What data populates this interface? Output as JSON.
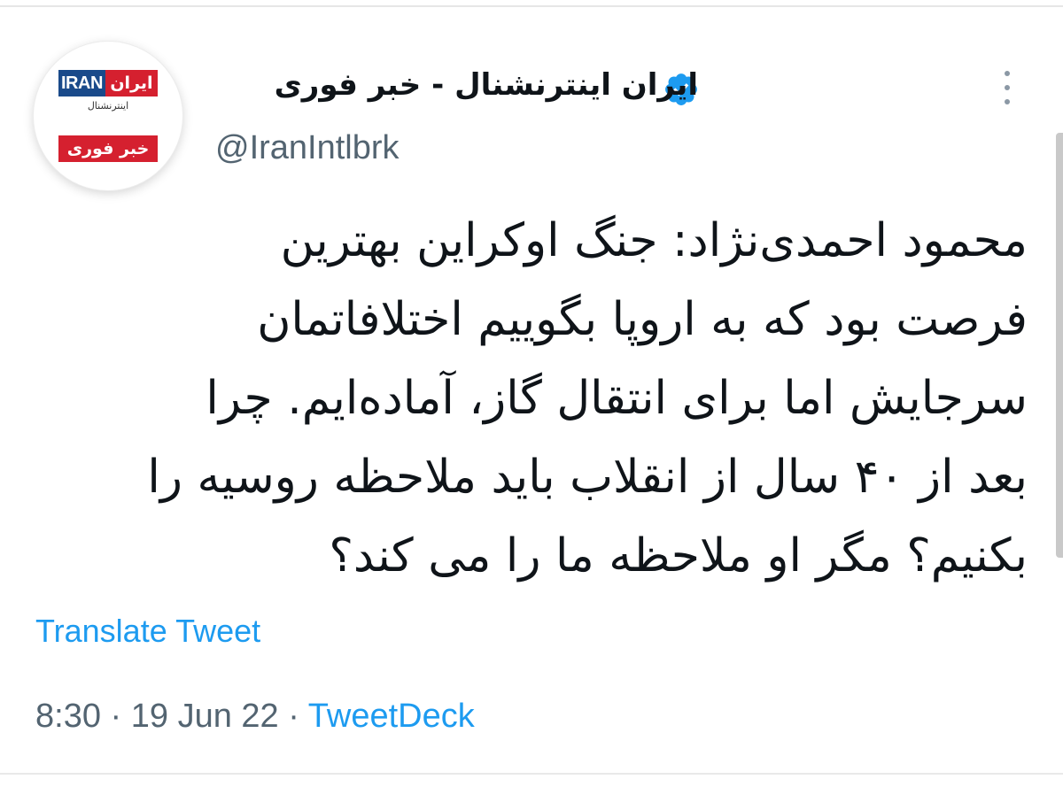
{
  "author": {
    "display_name": "ایران اینترنشنال - خبر فوری",
    "handle": "@IranIntlbrk",
    "verified": true,
    "avatar": {
      "logo_en": "IRAN",
      "logo_fa": "ایران",
      "logo_sub": "اینترنشنال",
      "logo_breaking": "خبر فوری"
    }
  },
  "tweet": {
    "lines": [
      "محمود احمدی‌نژاد: جنگ اوکراین بهترین",
      "فرصت بود که به اروپا بگوییم اختلافاتمان",
      "سرجایش اما برای انتقال گاز، آماده‌ایم. چرا",
      "بعد از ۴۰ سال از انقلاب باید ملاحظه روسیه را",
      "بکنیم؟ مگر او ملاحظه ما را می کند؟"
    ],
    "translate_label": "Translate Tweet"
  },
  "meta": {
    "time": "8:30",
    "separator": " · ",
    "date": "19 Jun 22",
    "source": "TweetDeck"
  },
  "icons": {
    "verified": "verified-badge-icon",
    "more": "more-options-icon"
  },
  "colors": {
    "link": "#1d9bf0",
    "muted": "#536471",
    "text": "#0f1419",
    "brand_red": "#d5202f",
    "brand_blue": "#1a4a8a"
  }
}
